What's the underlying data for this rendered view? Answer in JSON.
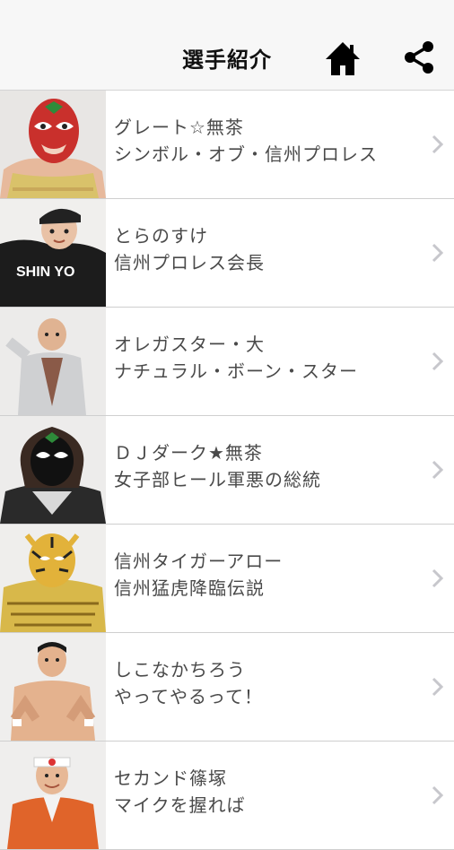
{
  "header": {
    "title": "選手紹介",
    "home_icon": "home-icon",
    "share_icon": "share-icon"
  },
  "wrestlers": [
    {
      "name": "グレート☆無茶",
      "subtitle": "シンボル・オブ・信州プロレス"
    },
    {
      "name": "とらのすけ",
      "subtitle": "信州プロレス会長"
    },
    {
      "name": "オレガスター・大",
      "subtitle": "ナチュラル・ボーン・スター"
    },
    {
      "name": "ＤＪダーク★無茶",
      "subtitle": "女子部ヒール軍悪の総統"
    },
    {
      "name": "信州タイガーアロー",
      "subtitle": "信州猛虎降臨伝説"
    },
    {
      "name": "しこなかちろう",
      "subtitle": "やってやるって！"
    },
    {
      "name": "セカンド篠塚",
      "subtitle": "マイクを握れば"
    }
  ],
  "colors": {
    "navbar_bg": "#f7f7f7",
    "chevron": "#c7c7cc",
    "text": "#4a4a4a"
  }
}
